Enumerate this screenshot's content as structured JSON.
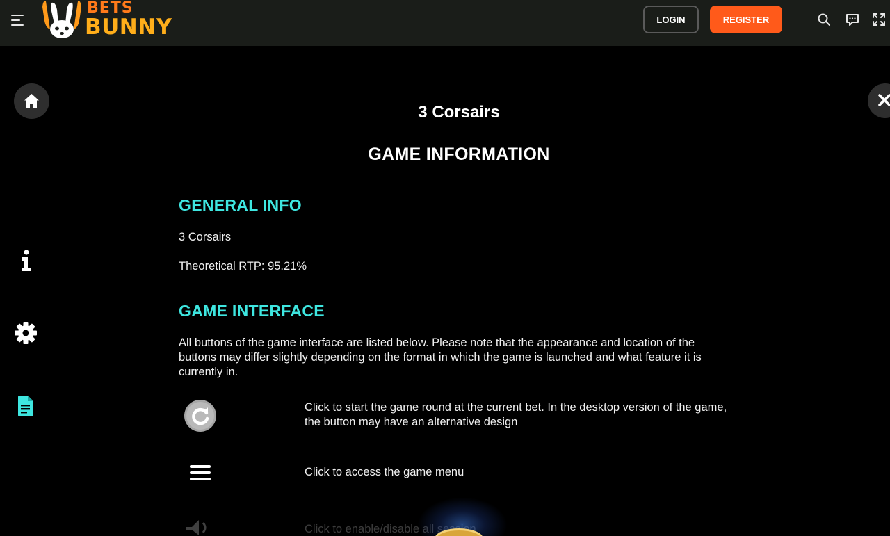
{
  "header": {
    "logo_top": "BETS",
    "logo_bottom": "BUNNY",
    "login_label": "LOGIN",
    "register_label": "REGISTER",
    "icons": [
      "menu-icon",
      "search-icon",
      "chat-icon",
      "fullscreen-icon"
    ],
    "colors": {
      "bar": "#1a1d19",
      "register": "#ff5a1a",
      "logo_orange": "#ff7a1a",
      "logo_yellow": "#ffae1a"
    }
  },
  "rail": {
    "icons": [
      "home-icon",
      "info-icon",
      "settings-gear-icon",
      "document-icon"
    ],
    "active": "document-icon",
    "active_color": "#3ee6e0"
  },
  "content": {
    "game_title": "3 Corsairs",
    "page_title": "GAME INFORMATION",
    "general": {
      "heading": "GENERAL INFO",
      "name": "3 Corsairs",
      "rtp": "Theoretical RTP: 95.21%"
    },
    "interface": {
      "heading": "GAME INTERFACE",
      "intro": "All buttons of the game interface are listed below. Please note that the appearance and location of the buttons may differ slightly depending on the format in which the game is launched and what feature it is currently in.",
      "rows": [
        {
          "icon": "spin-icon",
          "text": "Click to start the game round at the current bet. In the desktop version of the game, the button may have an alternative design"
        },
        {
          "icon": "menu-lines-icon",
          "text": "Click to access the game menu"
        },
        {
          "icon": "sound-icon",
          "text": "Click to enable/disable all session"
        }
      ]
    },
    "heading_color": "#3ee6e0"
  }
}
